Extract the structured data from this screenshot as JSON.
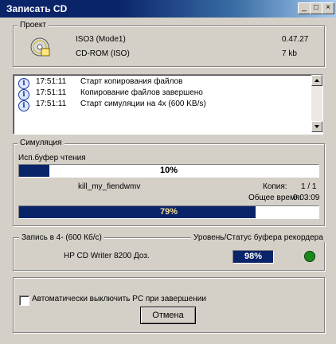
{
  "window": {
    "title": "Записать CD",
    "controls": [
      "_",
      "□",
      "×"
    ]
  },
  "project": {
    "legend": "Проект",
    "rows": [
      {
        "name": "ISO3 (Mode1)",
        "value": "0.47.27"
      },
      {
        "name": "CD-ROM (ISO)",
        "value": "7 kb"
      }
    ]
  },
  "log": [
    {
      "time": "17:51:11",
      "message": "Старт копирования файлов"
    },
    {
      "time": "17:51:11",
      "message": "Копирование файлов завершено"
    },
    {
      "time": "17:51:11",
      "message": "Старт симуляции на 4x (600 KB/s)"
    }
  ],
  "simulation": {
    "legend": "Симуляция",
    "buffer_label": "Исп.буфер чтения",
    "buffer_percent_text": "10%",
    "buffer_fraction": 0.1,
    "file_name": "kill_my_fiendwmv",
    "copy_label": "Копия:",
    "copy_value": "1 / 1",
    "total_time_label": "Общее время:",
    "total_time_value": "0:03:09",
    "progress_text": "79%",
    "progress_fraction": 0.79
  },
  "recorder": {
    "legend": "Запись в 4- (600 Кб/с)",
    "status_legend": "Уровень/Статус буфера рекордера",
    "device": "HP CD Writer 8200 Доз.",
    "buffer_text": "98%",
    "led_color": "#1a8a1a"
  },
  "footer": {
    "checkbox_label": "Автоматически выключить PC при завершении",
    "checkbox_checked": false,
    "cancel_label": "Отмена"
  }
}
